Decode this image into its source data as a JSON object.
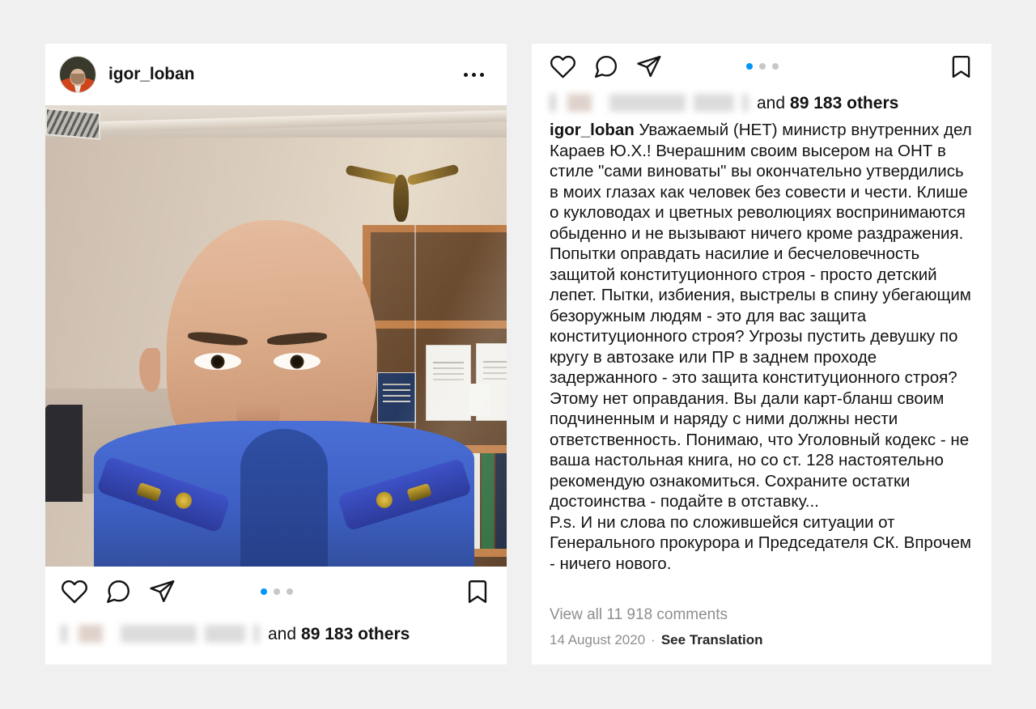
{
  "page": {
    "background_color": "#f0f0f0",
    "accent_color": "#0095f6",
    "text_color": "#131313",
    "muted_color": "#8e8e8e"
  },
  "post": {
    "header": {
      "username": "igor_loban",
      "avatar_alt": "igor_loban profile photo",
      "more_options_label": "•••"
    },
    "photo": {
      "alt": "Selfie of a man in a blue prosecutor uniform in an office with bookshelves, certificates and an eagle statuette"
    },
    "actions": {
      "like_label": "Like",
      "comment_label": "Comment",
      "share_label": "Share",
      "save_label": "Save"
    },
    "carousel": {
      "total": 3,
      "active_index": 1
    },
    "likes": {
      "names_blurred": true,
      "and_text": "and",
      "count_text": "89 183 others"
    }
  },
  "detail": {
    "actions": {
      "like_label": "Like",
      "comment_label": "Comment",
      "share_label": "Share",
      "save_label": "Save"
    },
    "carousel": {
      "total": 3,
      "active_index": 1
    },
    "likes": {
      "names_blurred": true,
      "and_text": "and",
      "count_text": "89 183 others"
    },
    "caption": {
      "username": "igor_loban",
      "paragraphs": [
        "Уважаемый (НЕТ) министр внутренних дел Караев Ю.Х.! Вчерашним своим высером на ОНТ в стиле \"сами виноваты\" вы окончательно утвердились в моих глазах  как человек без совести и чести. Клише о кукловодах и цветных революциях воспринимаются обыденно и не вызывают ничего кроме раздражения.",
        "Попытки оправдать насилие и бесчеловечность защитой конституционного строя - просто детский лепет. Пытки, избиения, выстрелы в спину убегающим безоружным людям - это для вас защита конституционного строя? Угрозы пустить девушку по кругу в автозаке или ПР в заднем проходе задержанного - это защита конституционного строя? Этому нет оправдания. Вы дали карт-бланш своим подчиненным и наряду с ними должны нести ответственность. Понимаю, что Уголовный кодекс - не ваша настольная книга, но со ст. 128 настоятельно рекомендую ознакомиться. Сохраните остатки достоинства - подайте в отставку...",
        "P.s. И ни слова по сложившейся ситуации от Генерального прокурора и Председателя СК. Впрочем - ничего нового."
      ]
    },
    "view_comments": "View all 11 918 comments",
    "date": "14 August 2020",
    "separator": "·",
    "see_translation": "See Translation"
  }
}
